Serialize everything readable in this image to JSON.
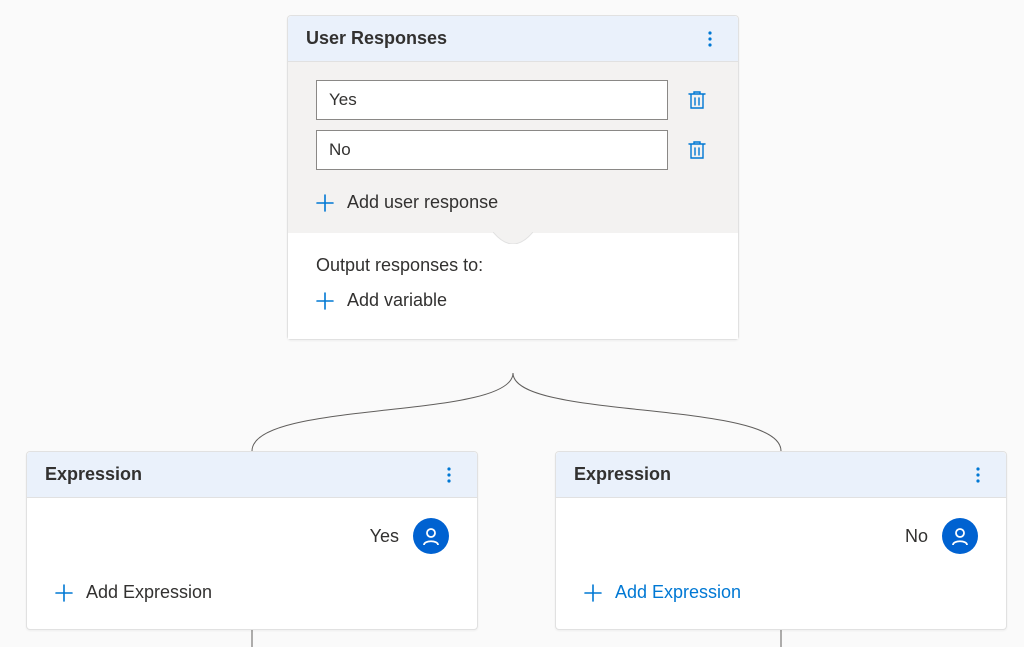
{
  "userResponses": {
    "title": "User Responses",
    "responses": [
      "Yes",
      "No"
    ],
    "addResponseLabel": "Add user response",
    "outputLabel": "Output responses to:",
    "addVariableLabel": "Add variable"
  },
  "expressions": [
    {
      "title": "Expression",
      "value": "Yes",
      "addLabel": "Add Expression",
      "accent": false
    },
    {
      "title": "Expression",
      "value": "No",
      "addLabel": "Add Expression",
      "accent": true
    }
  ]
}
